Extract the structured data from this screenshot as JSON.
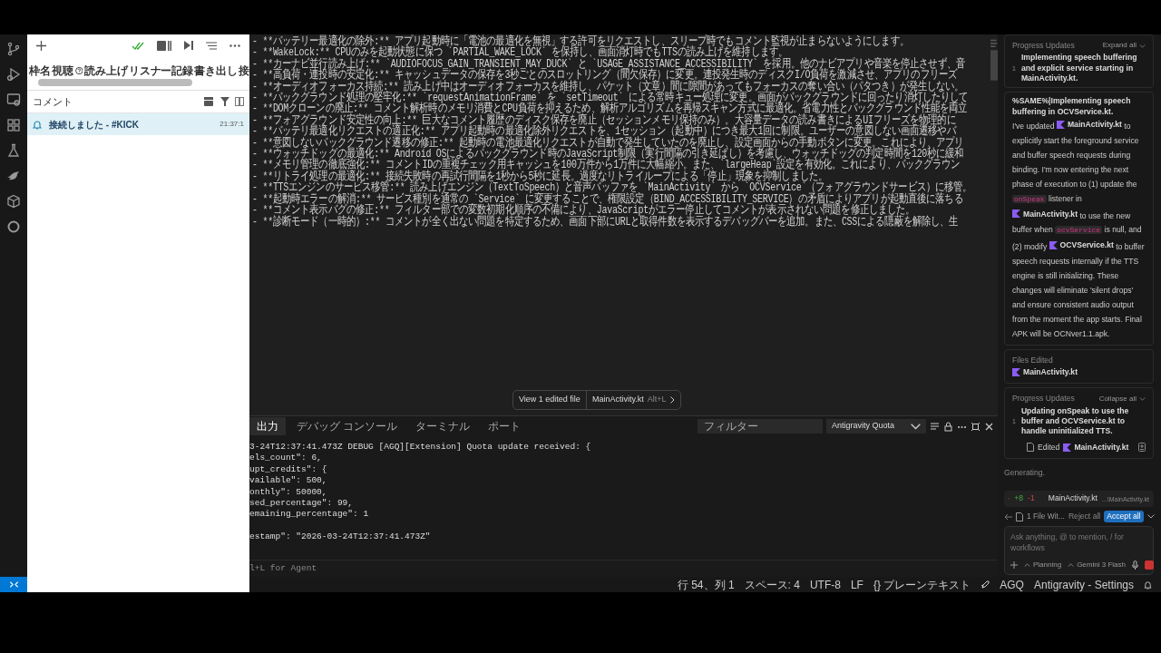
{
  "left_panel": {
    "columns": [
      "枠名",
      "視聴",
      "読み上げ",
      "リスナー記録",
      "書き出し",
      "接"
    ],
    "comments_title": "コメント",
    "comments": [
      {
        "text": "接続しました - #KICK",
        "time": "21:37:1",
        "selected": true
      }
    ]
  },
  "editor": {
    "lines": [
      "- **バッテリー最適化の除外:** アプリ起動時に「電池の最適化を無視」する許可をリクエストし、スリープ時でもコメント監視が止まらないようにします。",
      "- **WakeLock:** CPUのみを起動状態に保つ `PARTIAL_WAKE_LOCK` を保持し、画面消灯時でもTTSの読み上げを維持します。",
      "- **カーナビ並行読み上げ:** `AUDIOFOCUS_GAIN_TRANSIENT_MAY_DUCK` と `USAGE_ASSISTANCE_ACCESSIBILITY` を採用。他のナビアプリや音楽を停止させず、音",
      "- **高負荷・連投時の安定化:** キャッシュデータの保存を3秒ごとのスロットリング（間欠保存）に変更。連投発生時のディスクI/O負荷を激減させ、アプリのフリーズ",
      "- **オーディオフォーカス持続:** 読み上げ中はオーディオフォーカスを維持し、パケット（文章）間に隙間があってもフォーカスの奪い合い（パタつき）が発生しない。",
      "- **バックグラウンド処理の堅牢化:** `requestAnimationFrame` を `setTimeout` による常時キュー処理に変更。画面がバックグラウンドに回ったり消灯したりして",
      "- **DOMクローンの廃止:** コメント解析時のメモリ消費とCPU負荷を抑えるため、解析アルゴリズムを再帰スキャン方式に最適化。省電力性とバックグラウンド性能を両立",
      "- **フォアグラウンド安定性の向上:** 巨大なコメント履歴のディスク保存を廃止（セッションメモリ保持のみ）。大容量データの読み書きによるUIフリーズを物理的に",
      "- **バッテリ最適化リクエストの適正化:** アプリ起動時の最適化除外リクエストを、1セッション（起動中）につき最大1回に制限。ユーザーの意図しない画面遷移やバ",
      "- **意図しないバックグラウンド遷移の修正:** 起動時の電池最適化リクエストが自動で発生していたのを廃止し、設定画面からの手動ボタンに変更。これにより、アプリ",
      "- **ウォッチドッグの最適化:** Android OSによるバックグラウンド時のJavaScript制限（実行間隔の引き延ばし）を考慮し、ウォッチドッグの判定時間を120秒に緩和",
      "- **メモリ管理の徹底強化:** コメントIDの重複チェック用キャッシュを100万件から1万件に大幅縮小。また、`largeHeap`設定を有効化。これにより、バックグラウン",
      "- **リトライ処理の最適化:** 接続失敗時の再試行間隔を1秒から5秒に延長。過度なリトライループによる「停止」現象を抑制しました。",
      "- **TTSエンジンのサービス移管:** 読み上げエンジン（TextToSpeech）と音声バッファを `MainActivity` から `OCVService`（フォアグラウンドサービス）に移管。",
      "- **起動時エラーの解消:** サービス種別を通常の `Service` に変更することで、権限設定（BIND_ACCESSIBILITY_SERVICE）の矛盾によりアプリが起動直後に落ちる",
      "- **コメント表示バグの修正:** フィルター部での変数初期化順序の不備により、JavaScriptがエラー停止してコメントが表示されない問題を修正しました。",
      "- **診断モード（一時的）:** コメントが全く出ない問題を特定するため、画面下部にURLと取得件数を表示するデバッグバーを追加。また、CSSによる隠蔽を解除し、生"
    ]
  },
  "edited_file_bar": {
    "label": "View 1 edited file",
    "file": "MainActivity.kt",
    "shortcut": "Alt+L"
  },
  "panel": {
    "tabs": [
      {
        "label": "出力",
        "selected": true
      },
      {
        "label": "デバッグ コンソール",
        "selected": false
      },
      {
        "label": "ターミナル",
        "selected": false
      },
      {
        "label": "ポート",
        "selected": false
      }
    ],
    "filter": {
      "placeholder": "フィルター"
    },
    "channel": "Antigravity Quota",
    "output_lines": [
      {
        "kind": "text",
        "text": "3-24T12:37:41.473Z DEBUG [AGQ][Extension] Quota update received: {"
      },
      {
        "kind": "text",
        "text": "els_count\": 6,"
      },
      {
        "kind": "text",
        "text": "upt_credits\": {"
      },
      {
        "kind": "text",
        "text": "vailable\": 500,"
      },
      {
        "kind": "text",
        "text": "onthly\": 50000,"
      },
      {
        "kind": "text",
        "text": "sed_percentage\": 99,"
      },
      {
        "kind": "text",
        "text": "emaining_percentage\": 1"
      },
      {
        "kind": "blank"
      },
      {
        "kind": "text",
        "text": "estamp\": \"2026-03-24T12:37:41.473Z\""
      }
    ],
    "agent_hint": "l+L for Agent"
  },
  "agent": {
    "progress_1": {
      "title": "Progress Updates",
      "toggle": "Expand all",
      "items": [
        {
          "number": "1",
          "text": "Implementing speech buffering and explicit service starting in MainActivity.kt."
        }
      ]
    },
    "message": {
      "heading": "%SAME%|Implementing speech buffering in OCVService.kt.",
      "segments": [
        {
          "kind": "text",
          "text": "I've updated "
        },
        {
          "kind": "file",
          "text": "MainActivity.kt"
        },
        {
          "kind": "text",
          "text": " to explicitly start the foreground service and buffer speech requests during binding. I'm now entering the next phase of execution to (1) update the "
        },
        {
          "kind": "code",
          "text": "onSpeak"
        },
        {
          "kind": "text",
          "text": " listener in "
        },
        {
          "kind": "file",
          "text": "MainActivity.kt"
        },
        {
          "kind": "text",
          "text": " to use the new buffer when "
        },
        {
          "kind": "code",
          "text": "ocvService"
        },
        {
          "kind": "text",
          "text": " is null, and (2) modify "
        },
        {
          "kind": "file",
          "text": "OCVService.kt"
        },
        {
          "kind": "text",
          "text": " to buffer speech requests internally if the TTS engine is still initializing. These changes will eliminate 'silent drops' and ensure consistent audio output from the moment the app starts. Final APK will be OCNver1.1.apk."
        }
      ]
    },
    "files_edited": {
      "title": "Files Edited",
      "files": [
        "MainActivity.kt"
      ]
    },
    "progress_2": {
      "title": "Progress Updates",
      "toggle": "Collapse all",
      "items": [
        {
          "number": "1",
          "text": "Updating onSpeak to use the buffer and OCVService.kt to handle uninitialized TTS."
        }
      ],
      "edited_label": "Edited",
      "edited_file": "MainActivity.kt"
    },
    "status": "Generating.",
    "change": {
      "added": "+8",
      "removed": "-1",
      "file": "MainActivity.kt",
      "path": "...\\MainActivity.kt"
    },
    "review": {
      "summary": "1 File Wit...",
      "reject": "Reject all",
      "accept": "Accept all"
    },
    "input": {
      "placeholder": "Ask anything, @ to mention, / for workflows",
      "mode": "Planning",
      "model": "Gemini 3 Flash"
    }
  },
  "status_bar": [
    "行 54、列 1",
    "スペース: 4",
    "UTF-8",
    "LF",
    "{} プレーンテキスト",
    "AGQ",
    "Antigravity - Settings"
  ]
}
